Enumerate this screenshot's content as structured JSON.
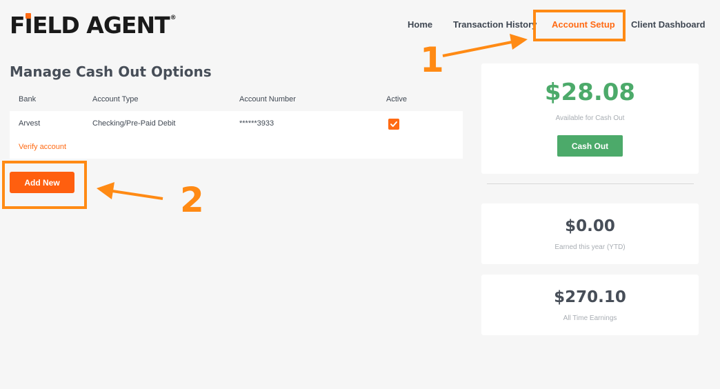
{
  "brand": {
    "logo_text_pre": "F",
    "logo_i": "I",
    "logo_text_post": "ELD AGENT",
    "reg": "®",
    "accent": "#ff6a13"
  },
  "nav": {
    "home": "Home",
    "transaction_history": "Transaction History",
    "account_setup": "Account Setup",
    "client_dashboard": "Client Dashboard"
  },
  "annotations": {
    "step1": "1",
    "step2": "2",
    "color": "#ff8a14"
  },
  "cashout": {
    "title": "Manage Cash Out Options",
    "headers": {
      "bank": "Bank",
      "account_type": "Account Type",
      "account_number": "Account Number",
      "active": "Active"
    },
    "rows": [
      {
        "bank": "Arvest",
        "account_type": "Checking/Pre-Paid Debit",
        "account_number": "******3933",
        "active": true,
        "verify_label": "Verify account"
      }
    ],
    "add_new_label": "Add New"
  },
  "summary": {
    "available": {
      "amount": "$28.08",
      "label": "Available for Cash Out",
      "button": "Cash Out",
      "color": "#4caa6a"
    },
    "ytd": {
      "amount": "$0.00",
      "label": "Earned this year (YTD)"
    },
    "all_time": {
      "amount": "$270.10",
      "label": "All Time Earnings"
    }
  }
}
